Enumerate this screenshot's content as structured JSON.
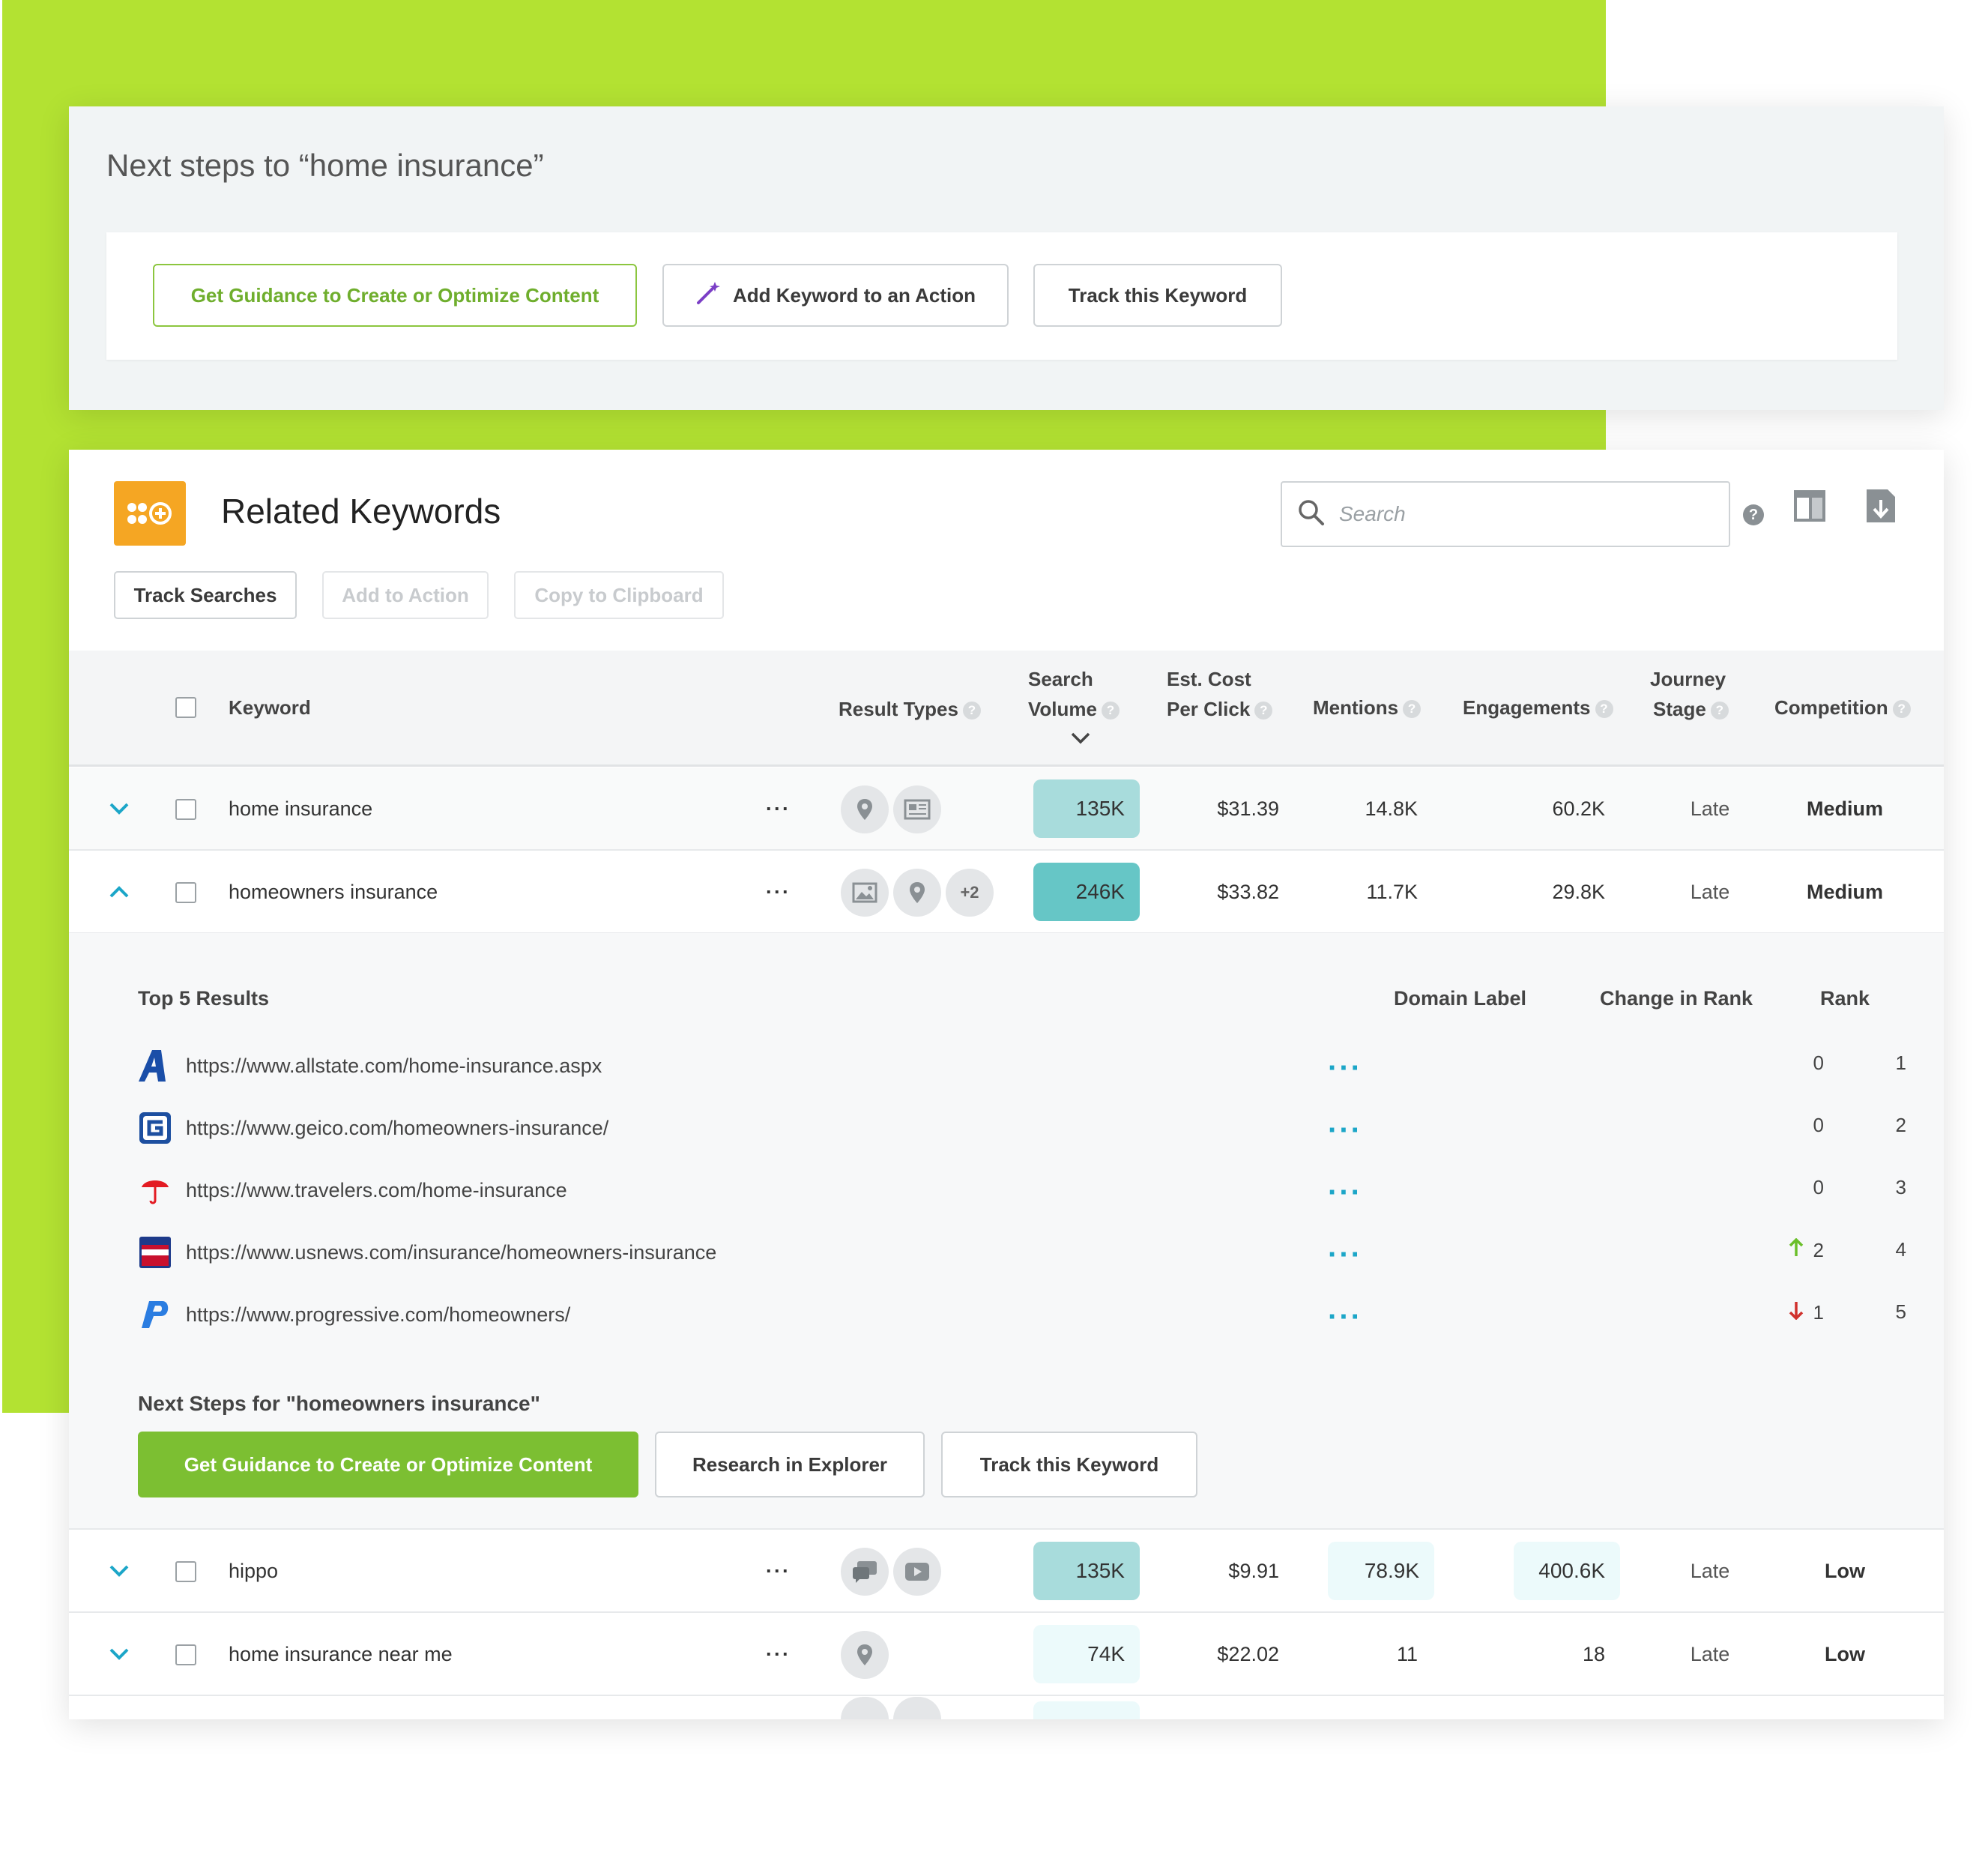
{
  "next_steps": {
    "title": "Next steps to “home insurance”",
    "buttons": {
      "guidance": "Get Guidance to Create or Optimize Content",
      "add_keyword": "Add Keyword to an Action",
      "track": "Track this Keyword"
    }
  },
  "panel": {
    "title": "Related Keywords",
    "search_placeholder": "Search",
    "help": "?",
    "actions": {
      "track_searches": "Track Searches",
      "add_to_action": "Add to Action",
      "copy_clipboard": "Copy to Clipboard"
    }
  },
  "columns": {
    "keyword": "Keyword",
    "result_types": "Result Types",
    "search_volume_1": "Search",
    "search_volume_2": "Volume",
    "cpc_1": "Est. Cost",
    "cpc_2": "Per Click",
    "mentions": "Mentions",
    "engagements": "Engagements",
    "journey_1": "Journey",
    "journey_2": "Stage",
    "competition": "Competition"
  },
  "rows": [
    {
      "keyword": "home insurance",
      "more": "···",
      "result_types": [
        "map-pin",
        "news"
      ],
      "volume": "135K",
      "cpc": "$31.39",
      "mentions": "14.8K",
      "engagements": "60.2K",
      "stage": "Late",
      "competition": "Medium"
    },
    {
      "keyword": "homeowners insurance",
      "more": "···",
      "result_types": [
        "image",
        "map-pin",
        "+2"
      ],
      "extra_types": "+2",
      "volume": "246K",
      "cpc": "$33.82",
      "mentions": "11.7K",
      "engagements": "29.8K",
      "stage": "Late",
      "competition": "Medium"
    },
    {
      "keyword": "hippo",
      "more": "···",
      "result_types": [
        "forum",
        "video"
      ],
      "volume": "135K",
      "cpc": "$9.91",
      "mentions": "78.9K",
      "engagements": "400.6K",
      "stage": "Late",
      "competition": "Low"
    },
    {
      "keyword": "home insurance near me",
      "more": "···",
      "result_types": [
        "map-pin"
      ],
      "volume": "74K",
      "cpc": "$22.02",
      "mentions": "11",
      "engagements": "18",
      "stage": "Late",
      "competition": "Low"
    }
  ],
  "expanded": {
    "header": "Top 5 Results",
    "domain_label": "Domain Label",
    "change_in_rank": "Change in Rank",
    "rank": "Rank",
    "results": [
      {
        "favicon": "allstate-logo",
        "url": "https://www.allstate.com/home-insurance.aspx",
        "more": "···",
        "change": "0",
        "direction": "none",
        "rank": "1"
      },
      {
        "favicon": "geico-logo",
        "url": "https://www.geico.com/homeowners-insurance/",
        "more": "···",
        "change": "0",
        "direction": "none",
        "rank": "2"
      },
      {
        "favicon": "travelers-umbrella-logo",
        "url": "https://www.travelers.com/home-insurance",
        "more": "···",
        "change": "0",
        "direction": "none",
        "rank": "3"
      },
      {
        "favicon": "usnews-logo",
        "url": "https://www.usnews.com/insurance/homeowners-insurance",
        "more": "···",
        "change": "2",
        "direction": "up",
        "rank": "4"
      },
      {
        "favicon": "progressive-logo",
        "url": "https://www.progressive.com/homeowners/",
        "more": "···",
        "change": "1",
        "direction": "down",
        "rank": "5"
      }
    ],
    "next_steps_title": "Next Steps for \"homeowners insurance\"",
    "buttons": {
      "guidance": "Get Guidance to Create or Optimize Content",
      "research": "Research in Explorer",
      "track": "Track this Keyword"
    }
  },
  "colors": {
    "brand_green": "#b3e232",
    "action_green": "#7cbf32",
    "accent_teal": "#1ca6c8",
    "medium": "#f4bf2a",
    "logo_orange": "#f5a623"
  }
}
